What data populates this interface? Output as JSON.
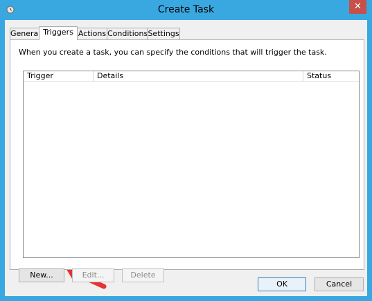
{
  "window": {
    "title": "Create Task",
    "close_glyph": "✕"
  },
  "tabs": [
    {
      "label": "General",
      "active": false
    },
    {
      "label": "Triggers",
      "active": true
    },
    {
      "label": "Actions",
      "active": false
    },
    {
      "label": "Conditions",
      "active": false
    },
    {
      "label": "Settings",
      "active": false
    }
  ],
  "triggers": {
    "description": "When you create a task, you can specify the conditions that will trigger the task.",
    "columns": [
      "Trigger",
      "Details",
      "Status"
    ],
    "rows": [],
    "buttons": {
      "new": "New...",
      "edit": "Edit...",
      "delete": "Delete"
    }
  },
  "footer": {
    "ok": "OK",
    "cancel": "Cancel"
  },
  "colors": {
    "window_border": "#3aa8e0",
    "annotation": "#e53333"
  }
}
